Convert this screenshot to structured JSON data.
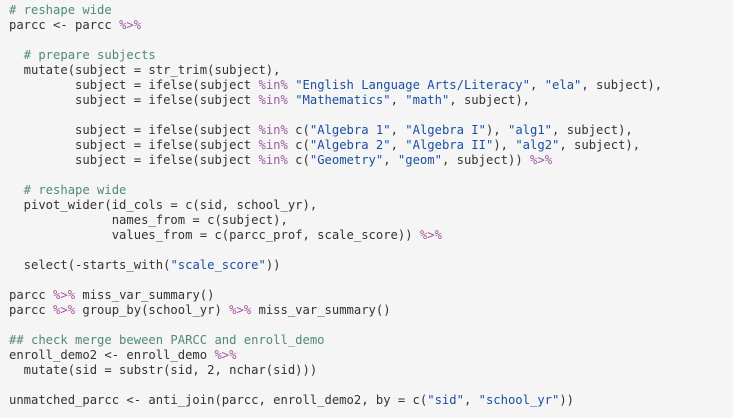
{
  "editor": {
    "theme_colors": {
      "background": "#f5f5f5",
      "plain": "#333333",
      "comment": "#4f8a78",
      "string": "#1a4fa0",
      "operator": "#a05aa0"
    },
    "lines": [
      [
        {
          "t": "comment",
          "s": "# reshape wide"
        }
      ],
      [
        {
          "t": "plain",
          "s": "parcc <- parcc "
        },
        {
          "t": "op",
          "s": "%>%"
        }
      ],
      [],
      [
        {
          "t": "comment",
          "s": "  # prepare subjects"
        }
      ],
      [
        {
          "t": "plain",
          "s": "  mutate(subject = str_trim(subject),"
        }
      ],
      [
        {
          "t": "plain",
          "s": "         subject = ifelse(subject "
        },
        {
          "t": "op",
          "s": "%in%"
        },
        {
          "t": "plain",
          "s": " "
        },
        {
          "t": "string",
          "s": "\"English Language Arts/Literacy\""
        },
        {
          "t": "plain",
          "s": ", "
        },
        {
          "t": "string",
          "s": "\"ela\""
        },
        {
          "t": "plain",
          "s": ", subject),"
        }
      ],
      [
        {
          "t": "plain",
          "s": "         subject = ifelse(subject "
        },
        {
          "t": "op",
          "s": "%in%"
        },
        {
          "t": "plain",
          "s": " "
        },
        {
          "t": "string",
          "s": "\"Mathematics\""
        },
        {
          "t": "plain",
          "s": ", "
        },
        {
          "t": "string",
          "s": "\"math\""
        },
        {
          "t": "plain",
          "s": ", subject),"
        }
      ],
      [],
      [
        {
          "t": "plain",
          "s": "         subject = ifelse(subject "
        },
        {
          "t": "op",
          "s": "%in%"
        },
        {
          "t": "plain",
          "s": " c("
        },
        {
          "t": "string",
          "s": "\"Algebra 1\""
        },
        {
          "t": "plain",
          "s": ", "
        },
        {
          "t": "string",
          "s": "\"Algebra I\""
        },
        {
          "t": "plain",
          "s": "), "
        },
        {
          "t": "string",
          "s": "\"alg1\""
        },
        {
          "t": "plain",
          "s": ", subject),"
        }
      ],
      [
        {
          "t": "plain",
          "s": "         subject = ifelse(subject "
        },
        {
          "t": "op",
          "s": "%in%"
        },
        {
          "t": "plain",
          "s": " c("
        },
        {
          "t": "string",
          "s": "\"Algebra 2\""
        },
        {
          "t": "plain",
          "s": ", "
        },
        {
          "t": "string",
          "s": "\"Algebra II\""
        },
        {
          "t": "plain",
          "s": "), "
        },
        {
          "t": "string",
          "s": "\"alg2\""
        },
        {
          "t": "plain",
          "s": ", subject),"
        }
      ],
      [
        {
          "t": "plain",
          "s": "         subject = ifelse(subject "
        },
        {
          "t": "op",
          "s": "%in%"
        },
        {
          "t": "plain",
          "s": " c("
        },
        {
          "t": "string",
          "s": "\"Geometry\""
        },
        {
          "t": "plain",
          "s": ", "
        },
        {
          "t": "string",
          "s": "\"geom\""
        },
        {
          "t": "plain",
          "s": ", subject)) "
        },
        {
          "t": "op",
          "s": "%>%"
        }
      ],
      [],
      [
        {
          "t": "comment",
          "s": "  # reshape wide"
        }
      ],
      [
        {
          "t": "plain",
          "s": "  pivot_wider(id_cols = c(sid, school_yr),"
        }
      ],
      [
        {
          "t": "plain",
          "s": "              names_from = c(subject),"
        }
      ],
      [
        {
          "t": "plain",
          "s": "              values_from = c(parcc_prof, scale_score)) "
        },
        {
          "t": "op",
          "s": "%>%"
        }
      ],
      [],
      [
        {
          "t": "plain",
          "s": "  select(-starts_with("
        },
        {
          "t": "string",
          "s": "\"scale_score\""
        },
        {
          "t": "plain",
          "s": "))"
        }
      ],
      [],
      [
        {
          "t": "plain",
          "s": "parcc "
        },
        {
          "t": "op",
          "s": "%>%"
        },
        {
          "t": "plain",
          "s": " miss_var_summary()"
        }
      ],
      [
        {
          "t": "plain",
          "s": "parcc "
        },
        {
          "t": "op",
          "s": "%>%"
        },
        {
          "t": "plain",
          "s": " group_by(school_yr) "
        },
        {
          "t": "op",
          "s": "%>%"
        },
        {
          "t": "plain",
          "s": " miss_var_summary()"
        }
      ],
      [],
      [
        {
          "t": "comment",
          "s": "## check merge beween PARCC and enroll_demo"
        }
      ],
      [
        {
          "t": "plain",
          "s": "enroll_demo2 <- enroll_demo "
        },
        {
          "t": "op",
          "s": "%>%"
        }
      ],
      [
        {
          "t": "plain",
          "s": "  mutate(sid = substr(sid, 2, nchar(sid)))"
        }
      ],
      [],
      [
        {
          "t": "plain",
          "s": "unmatched_parcc <- anti_join(parcc, enroll_demo2, by = c("
        },
        {
          "t": "string",
          "s": "\"sid\""
        },
        {
          "t": "plain",
          "s": ", "
        },
        {
          "t": "string",
          "s": "\"school_yr\""
        },
        {
          "t": "plain",
          "s": "))"
        }
      ]
    ]
  }
}
